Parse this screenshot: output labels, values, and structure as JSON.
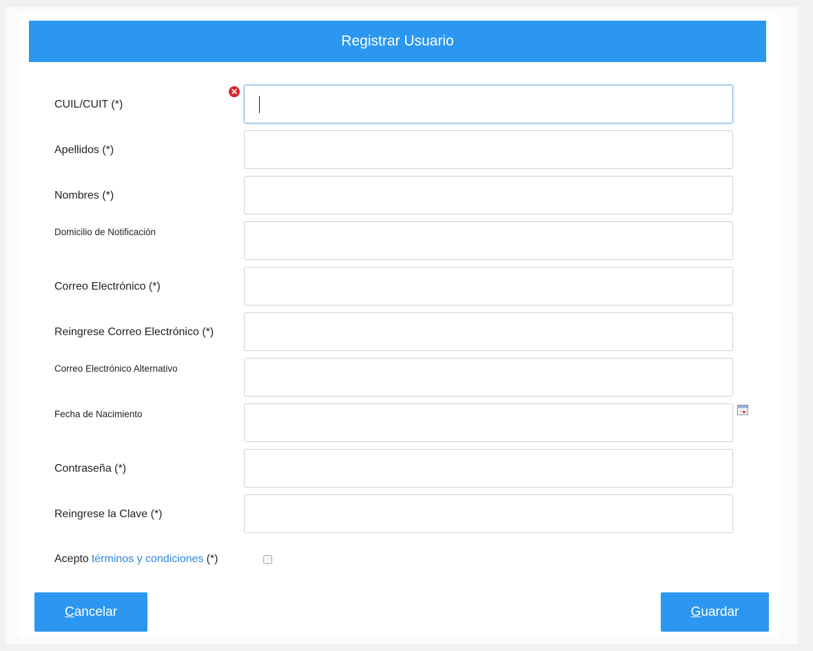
{
  "form": {
    "title": "Registrar Usuario",
    "fields": [
      {
        "label": "CUIL/CUIT (*)",
        "value": "",
        "placeholder": ""
      },
      {
        "label": "Apellidos (*)",
        "value": "",
        "placeholder": ""
      },
      {
        "label": "Nombres (*)",
        "value": "",
        "placeholder": ""
      },
      {
        "label": "Domicilio de Notificación",
        "value": "",
        "placeholder": ""
      },
      {
        "label": "Correo Electrónico (*)",
        "value": "",
        "placeholder": ""
      },
      {
        "label": "Reingrese Correo Electrónico (*)",
        "value": "",
        "placeholder": ""
      },
      {
        "label": "Correo Electrónico Alternativo",
        "value": "",
        "placeholder": ""
      },
      {
        "label": "Fecha de Nacimiento",
        "value": "",
        "placeholder": ""
      },
      {
        "label": "Contraseña (*)",
        "value": "",
        "placeholder": ""
      },
      {
        "label": "Reingrese la Clave (*)",
        "value": "",
        "placeholder": ""
      }
    ],
    "terms": {
      "prefix": "Acepto",
      "link": "términos y condiciones",
      "suffix": "(*)",
      "checked": false
    },
    "buttons": {
      "cancel_accesskey": "C",
      "cancel_rest": "ancelar",
      "save_accesskey": "G",
      "save_rest": "uardar"
    }
  },
  "icons": {
    "error": "error-icon",
    "calendar": "calendar-icon"
  },
  "colors": {
    "accent": "#2c97f0",
    "link": "#2b87d8",
    "error": "#d9262c"
  }
}
